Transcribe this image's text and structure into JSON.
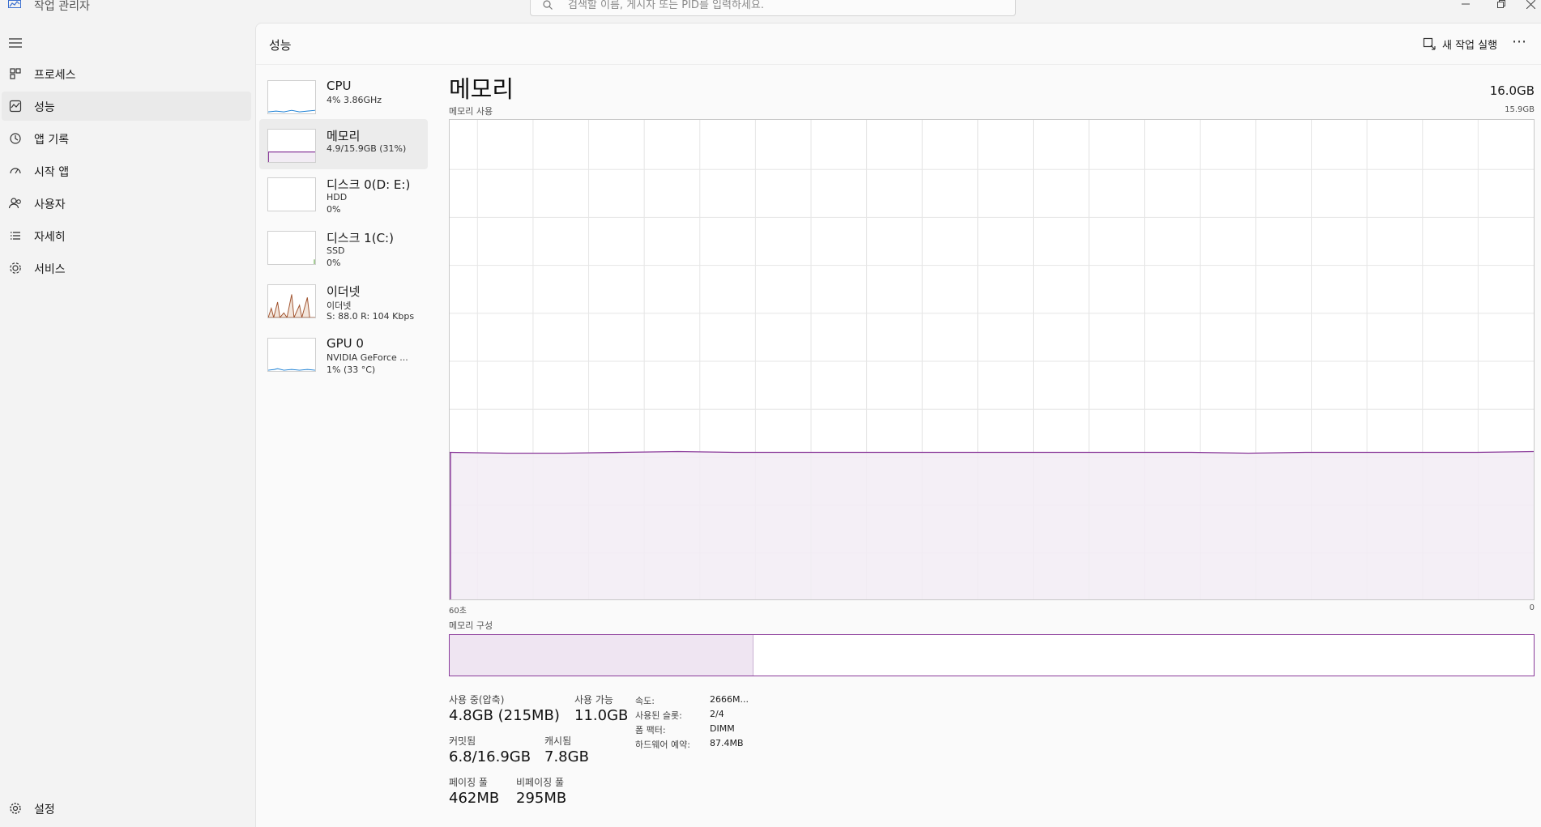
{
  "window": {
    "title": "작업 관리자",
    "search_placeholder": "검색할 이름, 게시자 또는 PID를 입력하세요.",
    "minimize_icon": "minimize-icon",
    "maximize_icon": "restore-icon",
    "close_icon": "close-icon"
  },
  "sidebar": {
    "items": [
      {
        "label": "프로세스",
        "icon": "processes-icon"
      },
      {
        "label": "성능",
        "icon": "performance-icon"
      },
      {
        "label": "앱 기록",
        "icon": "history-icon"
      },
      {
        "label": "시작 앱",
        "icon": "startup-icon"
      },
      {
        "label": "사용자",
        "icon": "users-icon"
      },
      {
        "label": "자세히",
        "icon": "details-icon"
      },
      {
        "label": "서비스",
        "icon": "services-icon"
      }
    ],
    "settings_label": "설정",
    "active_index": 1
  },
  "header": {
    "title": "성능",
    "new_task_label": "새 작업 실행",
    "more_label": "⋯"
  },
  "resources": [
    {
      "name": "CPU",
      "sub1": "4% 3.86GHz",
      "sub2": "",
      "color": "#1a7fd4"
    },
    {
      "name": "메모리",
      "sub1": "4.9/15.9GB (31%)",
      "sub2": "",
      "color": "#8a3a9a"
    },
    {
      "name": "디스크 0(D: E:)",
      "sub1": "HDD",
      "sub2": "0%",
      "color": "#4c9a2a"
    },
    {
      "name": "디스크 1(C:)",
      "sub1": "SSD",
      "sub2": "0%",
      "color": "#4c9a2a"
    },
    {
      "name": "이더넷",
      "sub1": "이더넷",
      "sub2": "S: 88.0 R: 104 Kbps",
      "color": "#a0522d"
    },
    {
      "name": "GPU 0",
      "sub1": "NVIDIA GeForce ...",
      "sub2": "1% (33 °C)",
      "color": "#1a7fd4"
    }
  ],
  "memory": {
    "title": "메모리",
    "total": "16.0GB",
    "usage_caption": "메모리 사용",
    "max_label": "15.9GB",
    "axis_left": "60초",
    "axis_right": "0",
    "composition_caption": "메모리 구성",
    "usage_fraction": 0.31,
    "in_use_fraction": 0.28,
    "stats": {
      "in_use_label": "사용 중(압축)",
      "in_use_value": "4.8GB (215MB)",
      "available_label": "사용 가능",
      "available_value": "11.0GB",
      "committed_label": "커밋됨",
      "committed_value": "6.8/16.9GB",
      "cached_label": "캐시됨",
      "cached_value": "7.8GB",
      "paged_label": "페이징 풀",
      "paged_value": "462MB",
      "nonpaged_label": "비페이징 풀",
      "nonpaged_value": "295MB"
    },
    "specs": {
      "speed_label": "속도:",
      "speed_value": "2666M...",
      "slots_label": "사용된 슬롯:",
      "slots_value": "2/4",
      "form_label": "폼 팩터:",
      "form_value": "DIMM",
      "reserved_label": "하드웨어 예약:",
      "reserved_value": "87.4MB"
    },
    "accent": "#8a3a9a",
    "fill": "#f2ecf4"
  }
}
